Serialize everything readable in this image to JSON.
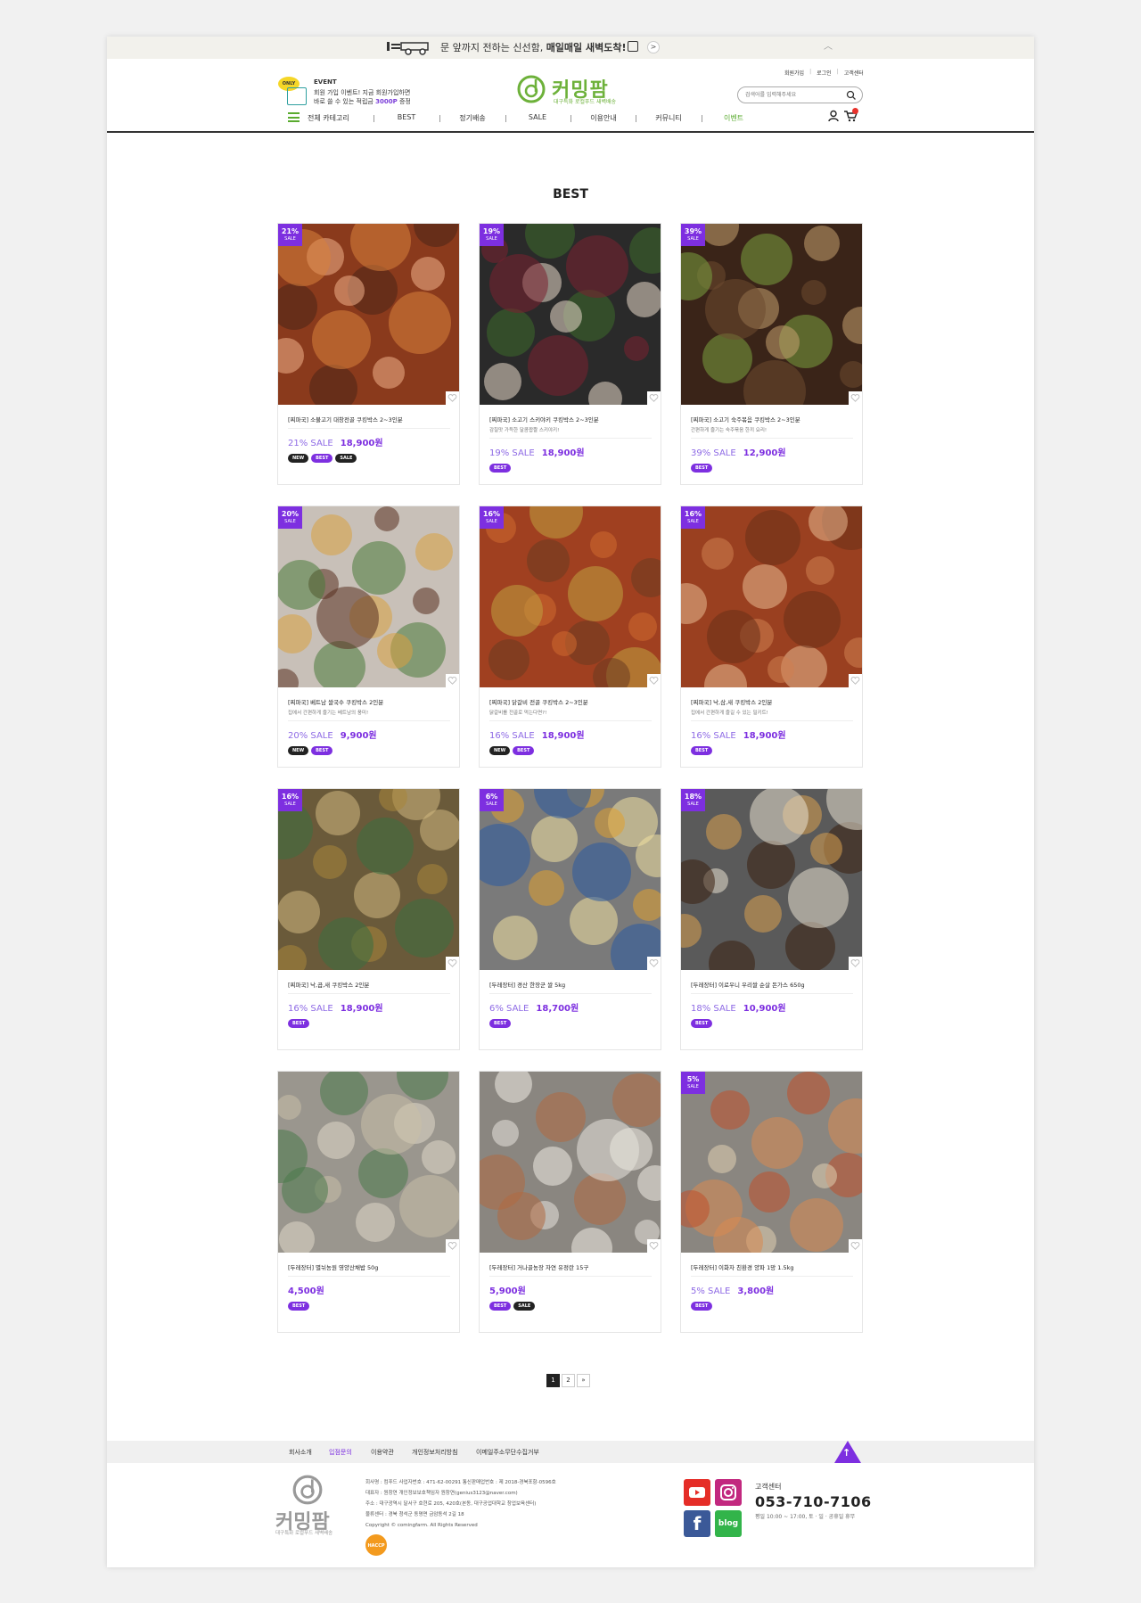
{
  "topbar": {
    "text_prefix": "문 앞까지 전하는 신선함,",
    "text_bold": "매일매일 새벽도착!",
    "arrow": ">",
    "collapse": "︿"
  },
  "event": {
    "only": "ONLY",
    "title": "EVENT",
    "line1": "회원 가입 이벤트! 지금 회원가입하면",
    "line2_prefix": "바로 쓸 수 있는 적립금",
    "line2_point": "3000P",
    "line2_suffix": "증정"
  },
  "logo": {
    "name": "커밍팜",
    "sub": "대구특화 로컬푸드 새벽배송"
  },
  "util": {
    "join": "회원가입",
    "login": "로그인",
    "cs": "고객센터"
  },
  "search": {
    "placeholder": "검색어를 입력해주세요"
  },
  "nav": {
    "all": "전체 카테고리",
    "items": [
      "BEST",
      "정기배송",
      "SALE",
      "이용안내",
      "커뮤니티",
      "이벤트"
    ]
  },
  "section": {
    "title": "BEST"
  },
  "products": [
    {
      "rate": "21%",
      "name": "[찌파국] 소불고기 대창전골 쿠킹박스 2~3인분",
      "desc": "",
      "sale_text": "21% SALE",
      "price": "18,900원",
      "tags": [
        "NEW",
        "BEST",
        "SALE"
      ]
    },
    {
      "rate": "19%",
      "name": "[찌파국] 소고기 스키야키 쿠킹박스 2~3인분",
      "desc": "감칠맛 가득한 달콤짭짤 스키야키!",
      "sale_text": "19% SALE",
      "price": "18,900원",
      "tags": [
        "BEST"
      ]
    },
    {
      "rate": "39%",
      "name": "[찌파국] 소고기 숙주볶음 쿠킹박스 2~3인분",
      "desc": "간편하게 즐기는 숙주볶음 한끼 요리!",
      "sale_text": "39% SALE",
      "price": "12,900원",
      "tags": [
        "BEST"
      ]
    },
    {
      "rate": "20%",
      "name": "[찌파국] 베트남 쌀국수 쿠킹박스 2인분",
      "desc": "집에서 간편하게 즐기는 베트남의 풍미!",
      "sale_text": "20% SALE",
      "price": "9,900원",
      "tags": [
        "NEW",
        "BEST"
      ]
    },
    {
      "rate": "16%",
      "name": "[찌파국] 닭갈비 전골 쿠킹박스 2~3인분",
      "desc": "닭갈비를 전골로 먹는다면?!",
      "sale_text": "16% SALE",
      "price": "18,900원",
      "tags": [
        "NEW",
        "BEST"
      ]
    },
    {
      "rate": "16%",
      "name": "[찌파국] 낙,삼,새 쿠킹박스 2인분",
      "desc": "집에서 간편하게 즐길 수 있는 밀키트!",
      "sale_text": "16% SALE",
      "price": "18,900원",
      "tags": [
        "BEST"
      ]
    },
    {
      "rate": "16%",
      "name": "[찌파국] 낙,곱,새 쿠킹박스 2인분",
      "desc": "",
      "sale_text": "16% SALE",
      "price": "18,900원",
      "tags": [
        "BEST"
      ]
    },
    {
      "rate": "6%",
      "name": "[두레장터] 경산 한장군 쌀 5kg",
      "desc": "",
      "sale_text": "6% SALE",
      "price": "18,700원",
      "tags": [
        "BEST"
      ]
    },
    {
      "rate": "18%",
      "name": "[두레장터] 이로우니 우리쌀 순살 돈가스 650g",
      "desc": "",
      "sale_text": "18% SALE",
      "price": "10,900원",
      "tags": [
        "BEST"
      ]
    },
    {
      "rate": "",
      "name": "[두레장터] 별뉘농원 영양산채밥 50g",
      "desc": "",
      "sale_text": "",
      "price": "4,500원",
      "tags": [
        "BEST"
      ]
    },
    {
      "rate": "",
      "name": "[두레장터] 거나골농장 자연 유정란 15구",
      "desc": "",
      "sale_text": "",
      "price": "5,900원",
      "tags": [
        "BEST",
        "SALE"
      ]
    },
    {
      "rate": "5%",
      "name": "[두레장터] 이화자 친환경 양파 1망 1.5kg",
      "desc": "",
      "sale_text": "5% SALE",
      "price": "3,800원",
      "tags": [
        "BEST"
      ]
    }
  ],
  "sale_label": "SALE",
  "pagination": {
    "pages": [
      "1",
      "2"
    ],
    "next": "»",
    "current": "1"
  },
  "footer": {
    "nav": [
      "회사소개",
      "입점문의",
      "이용약관",
      "개인정보처리방침",
      "이메일주소무단수집거부"
    ],
    "active_nav": "입점문의",
    "top": "↑",
    "info_lines": [
      "회사명 : 컴푸드 사업자번호 : 471-62-00291 통신판매업번호 : 제 2018-경북포항-0596호",
      "대표자 : 원창연 개인정보보호책임자 원창연(genius3123@naver.com)",
      "주소 : 대구광역시 달서구 호현로 205, 420호(본동, 대구공업대학교 창업보육센터)",
      "물류센터 : 경북 청석군 동명면 금암동석 2길 18",
      "Copyright © comingfarm. All Rights Reserved"
    ],
    "cert": "HACCP",
    "cs_title": "고객센터",
    "cs_tel": "053-710-7106",
    "cs_hours": "평일 10:00 ~ 17:00, 토 · 일 · 공휴일 휴무",
    "blog": "blog",
    "facebook": "f"
  },
  "colors": {
    "accent": "#7d2fe0",
    "green": "#6db13a"
  }
}
